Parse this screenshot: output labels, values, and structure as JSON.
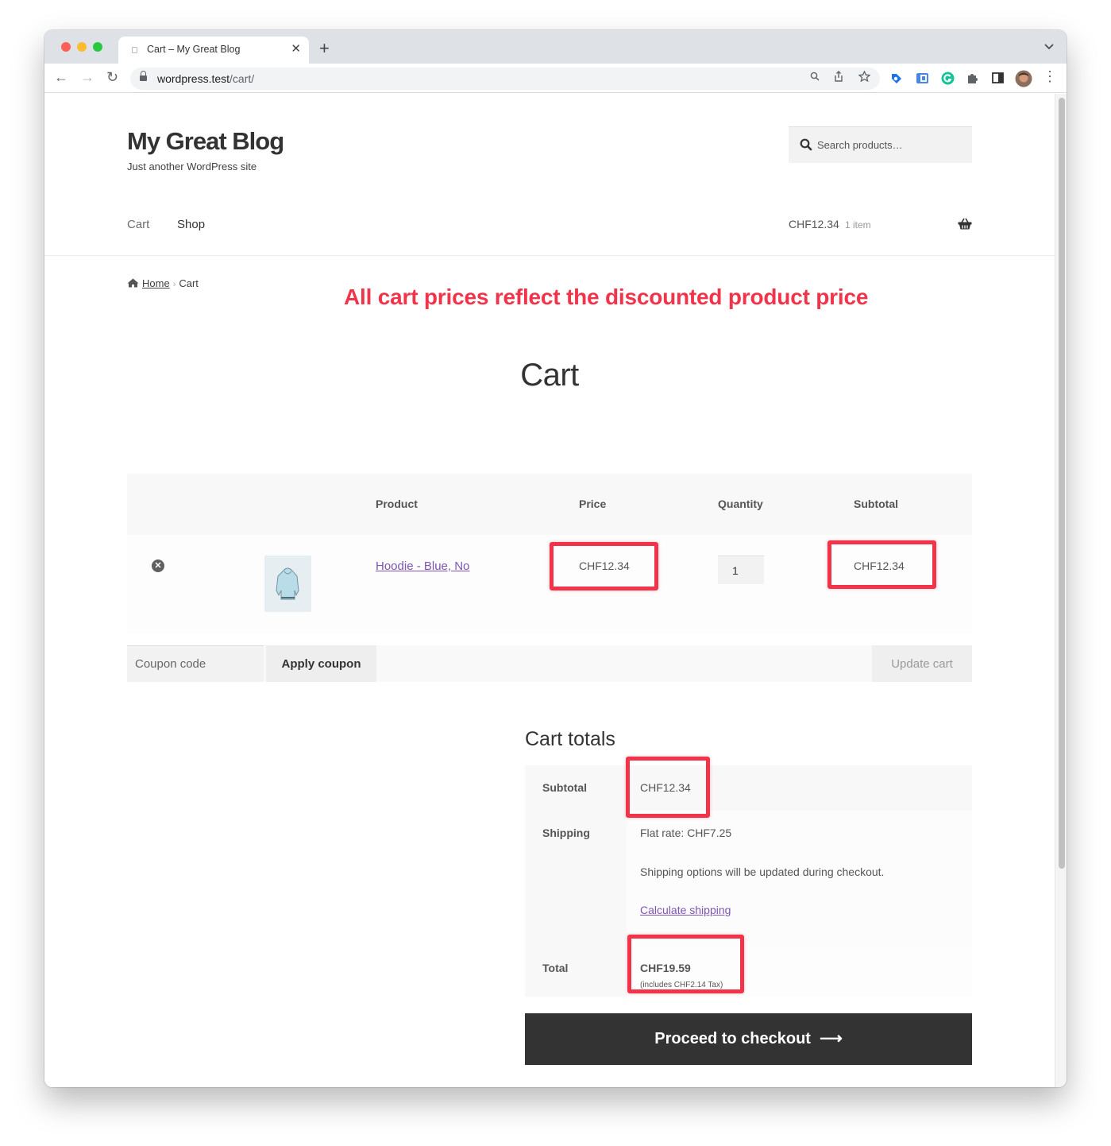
{
  "browser": {
    "tab_title": "Cart – My Great Blog",
    "tab_close": "✕",
    "new_tab": "+",
    "url_host": "wordpress.test",
    "url_path": "/cart/",
    "icons": {
      "back": "←",
      "forward": "→",
      "reload": "↻",
      "zoom": "⚲",
      "share": "⇪",
      "bookmark": "☆",
      "menu": "⋮",
      "tab_menu": "⌄"
    }
  },
  "site": {
    "title": "My Great Blog",
    "tagline": "Just another WordPress site",
    "search_placeholder": "Search products…"
  },
  "nav": {
    "items": [
      {
        "label": "Cart"
      },
      {
        "label": "Shop"
      }
    ],
    "mini_cart": {
      "amount": "CHF12.34",
      "count": "1 item"
    }
  },
  "breadcrumb": {
    "home": "Home",
    "separator": "›",
    "current": "Cart"
  },
  "annotation": {
    "text": "All cart prices reflect the discounted product price",
    "color": "#f2344b"
  },
  "page_title": "Cart",
  "cart_table": {
    "headers": [
      "Product",
      "Price",
      "Quantity",
      "Subtotal"
    ],
    "rows": [
      {
        "remove": "✕",
        "product": "Hoodie - Blue, No",
        "price": "CHF12.34",
        "quantity": "1",
        "subtotal": "CHF12.34"
      }
    ]
  },
  "actions": {
    "coupon_placeholder": "Coupon code",
    "apply_coupon": "Apply coupon",
    "update_cart": "Update cart"
  },
  "totals": {
    "title": "Cart totals",
    "subtotal_label": "Subtotal",
    "subtotal_value": "CHF12.34",
    "shipping_label": "Shipping",
    "shipping_method": "Flat rate: CHF7.25",
    "shipping_note": "Shipping options will be updated during checkout.",
    "calculate_shipping": "Calculate shipping",
    "total_label": "Total",
    "total_value": "CHF19.59",
    "tax_note": "(includes CHF2.14 Tax)"
  },
  "checkout": {
    "label": "Proceed to checkout",
    "arrow": "⟶"
  },
  "colors": {
    "accent_link": "#7f54b3",
    "highlight": "#f2344b",
    "checkout_bg": "#333333"
  }
}
